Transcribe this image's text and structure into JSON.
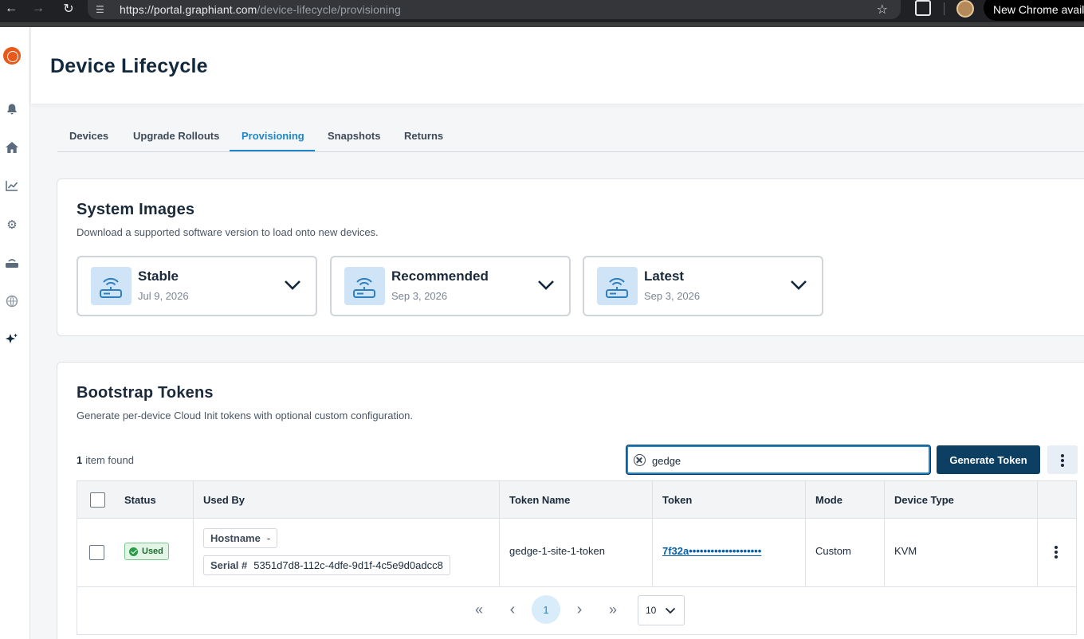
{
  "browser": {
    "url_host": "https://portal.graphiant.com",
    "url_path": "/device-lifecycle/provisioning",
    "update_label": "New Chrome availa"
  },
  "header": {
    "title": "Device Lifecycle"
  },
  "tabs": [
    {
      "label": "Devices"
    },
    {
      "label": "Upgrade Rollouts"
    },
    {
      "label": "Provisioning",
      "active": true
    },
    {
      "label": "Snapshots"
    },
    {
      "label": "Returns"
    }
  ],
  "system_images": {
    "title": "System Images",
    "subtitle": "Download a supported software version to load onto new devices.",
    "tiles": [
      {
        "name": "Stable",
        "date": "Jul 9, 2026"
      },
      {
        "name": "Recommended",
        "date": "Sep 3, 2026"
      },
      {
        "name": "Latest",
        "date": "Sep 3, 2026"
      }
    ]
  },
  "bootstrap": {
    "title": "Bootstrap Tokens",
    "subtitle": "Generate per-device Cloud Init tokens with optional custom configuration.",
    "count": "1",
    "count_label": "item found",
    "search_value": "gedge",
    "generate_label": "Generate Token",
    "columns": [
      "Status",
      "Used By",
      "Token Name",
      "Token",
      "Mode",
      "Device Type"
    ],
    "rows": [
      {
        "status": "Used",
        "hostname_key": "Hostname",
        "hostname_value": "-",
        "serial_key": "Serial #",
        "serial_value": "5351d7d8-112c-4dfe-9d1f-4c5e9d0adcc8",
        "token_name": "gedge-1-site-1-token",
        "token": "7f32a••••••••••••••••••••",
        "mode": "Custom",
        "device_type": "KVM"
      }
    ]
  },
  "pagination": {
    "current_page": "1",
    "page_size": "10",
    "first_glyph": "«",
    "prev_glyph": "‹",
    "next_glyph": "›",
    "last_glyph": "»"
  },
  "colors": {
    "accent": "#1f86c9",
    "primary_button": "#0d3f62",
    "used_badge": "#2a9b47",
    "logo": "#e8591a"
  }
}
